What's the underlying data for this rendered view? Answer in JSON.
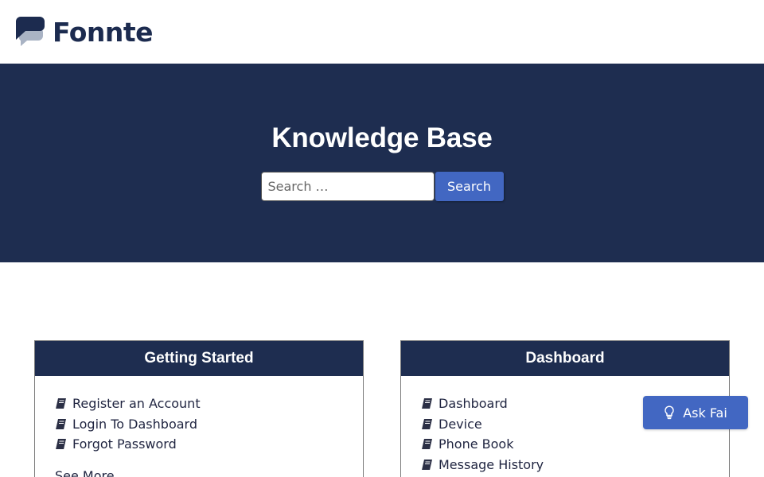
{
  "header": {
    "logo_text": "Fonnte",
    "logo_icon": "chat-bubble-logo-icon"
  },
  "hero": {
    "title": "Knowledge Base",
    "search_placeholder": "Search …",
    "search_value": "",
    "search_button": "Search"
  },
  "cards": {
    "getting_started": {
      "title": "Getting Started",
      "items": [
        "Register an Account",
        "Login To Dashboard",
        "Forgot Password"
      ],
      "see_more": "See More"
    },
    "dashboard": {
      "title": "Dashboard",
      "items": [
        "Dashboard",
        "Device",
        "Phone Book",
        "Message History"
      ]
    }
  },
  "ask_button": {
    "label": "Ask Fai",
    "icon": "lightbulb-icon"
  },
  "colors": {
    "navy": "#1e2d50",
    "accent": "#4267c2",
    "logo_gray": "#a9b3c4"
  }
}
